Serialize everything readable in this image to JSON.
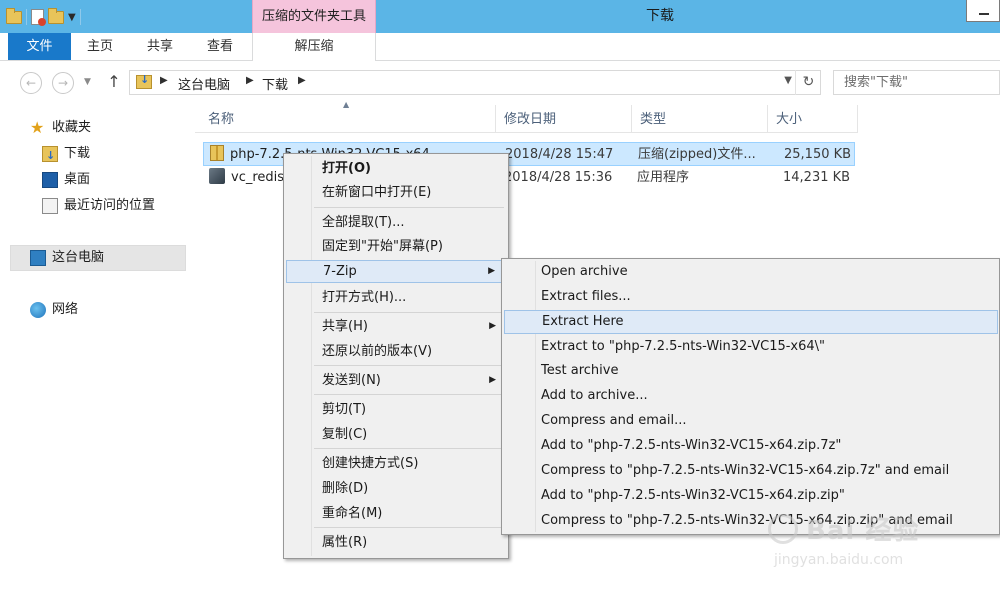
{
  "window": {
    "title": "下载",
    "context_tab": "压缩的文件夹工具"
  },
  "ribbon": {
    "tabs": [
      {
        "label": "文件"
      },
      {
        "label": "主页"
      },
      {
        "label": "共享"
      },
      {
        "label": "查看"
      },
      {
        "label": "解压缩"
      }
    ]
  },
  "address": {
    "crumbs": [
      "这台电脑",
      "下载"
    ],
    "search_placeholder": "搜索\"下载\""
  },
  "nav": {
    "items": [
      {
        "label": "收藏夹",
        "icon": "star-icon"
      },
      {
        "label": "下载",
        "icon": "downloads-folder-icon"
      },
      {
        "label": "桌面",
        "icon": "desktop-icon"
      },
      {
        "label": "最近访问的位置",
        "icon": "recent-places-icon"
      },
      {
        "label": "这台电脑",
        "icon": "this-pc-icon"
      },
      {
        "label": "网络",
        "icon": "network-icon"
      }
    ]
  },
  "files": {
    "columns": [
      "名称",
      "修改日期",
      "类型",
      "大小"
    ],
    "rows": [
      {
        "name": "php-7.2.5-nts-Win32-VC15-x64",
        "date": "2018/4/28 15:47",
        "type": "压缩(zipped)文件...",
        "size": "25,150 KB",
        "selected": true
      },
      {
        "name": "vc_redis",
        "date": "2018/4/28 15:36",
        "type": "应用程序",
        "size": "14,231 KB",
        "selected": false
      }
    ]
  },
  "context_menu": {
    "items": [
      {
        "label": "打开(O)"
      },
      {
        "label": "在新窗口中打开(E)"
      },
      {
        "label": "全部提取(T)..."
      },
      {
        "label": "固定到\"开始\"屏幕(P)"
      },
      {
        "label": "7-Zip"
      },
      {
        "label": "打开方式(H)..."
      },
      {
        "label": "共享(H)"
      },
      {
        "label": "还原以前的版本(V)"
      },
      {
        "label": "发送到(N)"
      },
      {
        "label": "剪切(T)"
      },
      {
        "label": "复制(C)"
      },
      {
        "label": "创建快捷方式(S)"
      },
      {
        "label": "删除(D)"
      },
      {
        "label": "重命名(M)"
      },
      {
        "label": "属性(R)"
      }
    ]
  },
  "submenu_7zip": {
    "items": [
      {
        "label": "Open archive"
      },
      {
        "label": "Extract files..."
      },
      {
        "label": "Extract Here"
      },
      {
        "label": "Extract to \"php-7.2.5-nts-Win32-VC15-x64\\\""
      },
      {
        "label": "Test archive"
      },
      {
        "label": "Add to archive..."
      },
      {
        "label": "Compress and email..."
      },
      {
        "label": "Add to \"php-7.2.5-nts-Win32-VC15-x64.zip.7z\""
      },
      {
        "label": "Compress to \"php-7.2.5-nts-Win32-VC15-x64.zip.7z\" and email"
      },
      {
        "label": "Add to \"php-7.2.5-nts-Win32-VC15-x64.zip.zip\""
      },
      {
        "label": "Compress to \"php-7.2.5-nts-Win32-VC15-x64.zip.zip\" and email"
      }
    ]
  },
  "watermark": {
    "line1": "Bai 经验",
    "line2": "jingyan.baidu.com"
  },
  "colors": {
    "titlebar": "#5bb5e6",
    "file_tab": "#1979ca",
    "context_tab": "#f5c4dc",
    "selection": "#cce8ff",
    "menu_highlight": "#dfeaf7"
  }
}
